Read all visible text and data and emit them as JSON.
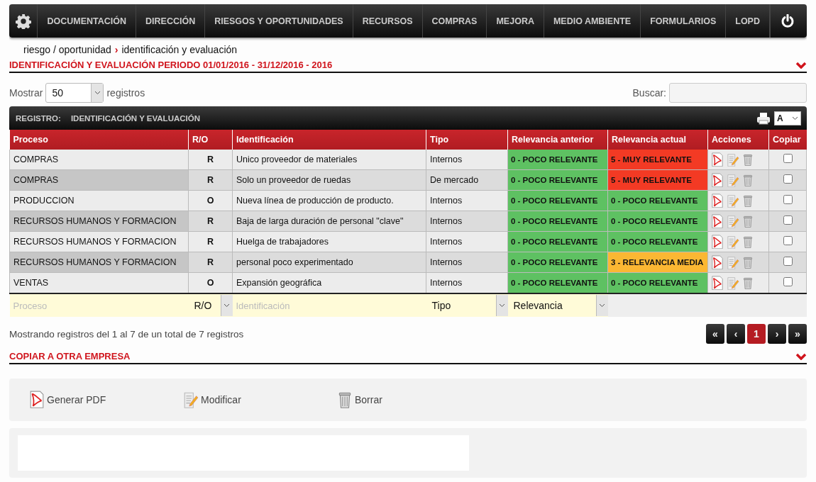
{
  "nav": {
    "items": [
      "DOCUMENTACIÓN",
      "DIRECCIÓN",
      "RIESGOS Y OPORTUNIDADES",
      "RECURSOS",
      "COMPRAS",
      "MEJORA",
      "MEDIO AMBIENTE",
      "FORMULARIOS",
      "LOPD"
    ]
  },
  "breadcrumb": {
    "parent": "riesgo / oportunidad",
    "separator": "›",
    "current": "identificación y evaluación"
  },
  "section_title": "IDENTIFICACIÓN Y EVALUACIÓN PERIODO 01/01/2016 - 31/12/2016 - 2016",
  "length": {
    "before": "Mostrar",
    "value": "50",
    "after": "registros"
  },
  "search": {
    "label": "Buscar:"
  },
  "panel": {
    "label": "REGISTRO:",
    "title": "IDENTIFICACIÓN Y EVALUACIÓN",
    "font_select": "A"
  },
  "table": {
    "columns": [
      "Proceso",
      "R/O",
      "Identificación",
      "Tipo",
      "Relevancia anterior",
      "Relevancia actual",
      "Acciones",
      "Copiar"
    ],
    "rows": [
      {
        "proceso": "COMPRAS",
        "ro": "R",
        "identificacion": "Unico proveedor de materiales",
        "tipo": "Internos",
        "anterior": {
          "text": "0 - POCO RELEVANTE",
          "color": "#5ec162"
        },
        "actual": {
          "text": "5 - MUY RELEVANTE",
          "color": "#f33a24"
        },
        "checked": false
      },
      {
        "proceso": "COMPRAS",
        "ro": "R",
        "identificacion": "Solo un proveedor de ruedas",
        "tipo": "De mercado",
        "anterior": {
          "text": "0 - POCO RELEVANTE",
          "color": "#5ec162"
        },
        "actual": {
          "text": "5 - MUY RELEVANTE",
          "color": "#f33a24"
        },
        "checked": false
      },
      {
        "proceso": "PRODUCCION",
        "ro": "O",
        "identificacion": "Nueva línea de producción de producto.",
        "tipo": "Internos",
        "anterior": {
          "text": "0 - POCO RELEVANTE",
          "color": "#5ec162"
        },
        "actual": {
          "text": "0 - POCO RELEVANTE",
          "color": "#5ec162"
        },
        "checked": false
      },
      {
        "proceso": "RECURSOS HUMANOS Y FORMACION",
        "ro": "R",
        "identificacion": "Baja de larga duración de personal \"clave\"",
        "tipo": "Internos",
        "anterior": {
          "text": "0 - POCO RELEVANTE",
          "color": "#5ec162"
        },
        "actual": {
          "text": "0 - POCO RELEVANTE",
          "color": "#5ec162"
        },
        "checked": false
      },
      {
        "proceso": "RECURSOS HUMANOS Y FORMACION",
        "ro": "R",
        "identificacion": "Huelga de trabajadores",
        "tipo": "Internos",
        "anterior": {
          "text": "0 - POCO RELEVANTE",
          "color": "#5ec162"
        },
        "actual": {
          "text": "0 - POCO RELEVANTE",
          "color": "#5ec162"
        },
        "checked": false
      },
      {
        "proceso": "RECURSOS HUMANOS Y FORMACION",
        "ro": "R",
        "identificacion": "personal poco experimentado",
        "tipo": "Internos",
        "anterior": {
          "text": "0 - POCO RELEVANTE",
          "color": "#5ec162"
        },
        "actual": {
          "text": "3 - RELEVANCIA MEDIA",
          "color": "#fbb733"
        },
        "checked": false
      },
      {
        "proceso": "VENTAS",
        "ro": "O",
        "identificacion": "Expansión geográfica",
        "tipo": "Internos",
        "anterior": {
          "text": "0 - POCO RELEVANTE",
          "color": "#5ec162"
        },
        "actual": {
          "text": "0 - POCO RELEVANTE",
          "color": "#5ec162"
        },
        "checked": false
      }
    ],
    "filters": {
      "proceso_placeholder": "Proceso",
      "ro": "R/O",
      "identificacion_placeholder": "Identificación",
      "tipo": "Tipo",
      "relevancia": "Relevancia"
    }
  },
  "info": "Mostrando registros del 1 al 7 de un total de 7 registros",
  "pagination": [
    {
      "label": "«",
      "selected": false
    },
    {
      "label": "‹",
      "selected": false
    },
    {
      "label": "1",
      "selected": true
    },
    {
      "label": "›",
      "selected": false
    },
    {
      "label": "»",
      "selected": false
    }
  ],
  "copy_section_title": "COPIAR A OTRA EMPRESA",
  "actions": [
    {
      "kind": "pdf",
      "label": "Generar PDF"
    },
    {
      "kind": "edit",
      "label": "Modificar"
    },
    {
      "kind": "delete",
      "label": "Borrar"
    }
  ]
}
